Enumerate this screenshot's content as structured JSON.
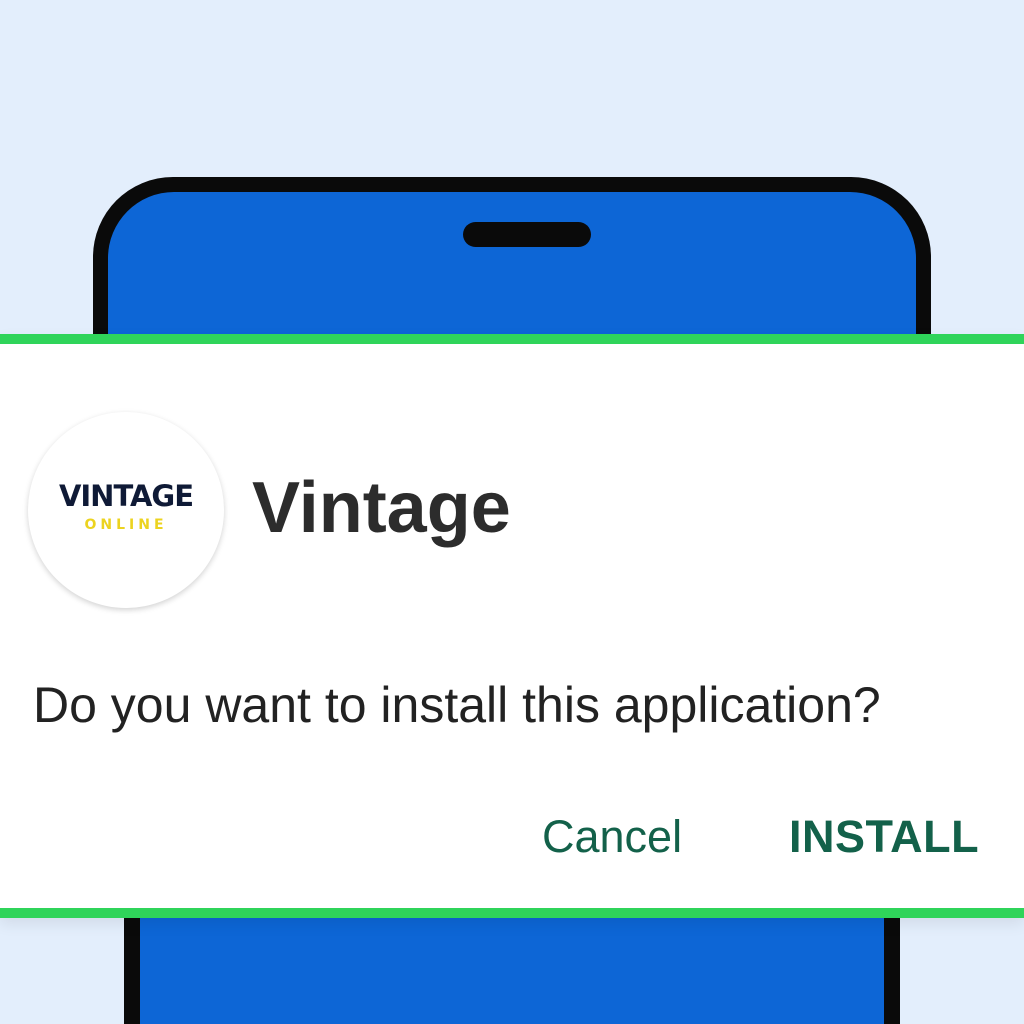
{
  "app": {
    "name": "Vintage",
    "logo": {
      "main_text": "VINTAGE",
      "sub_text": "ONLINE"
    }
  },
  "dialog": {
    "prompt": "Do you want to install this application?",
    "cancel_label": "Cancel",
    "install_label": "INSTALL"
  },
  "colors": {
    "background": "#e3eefc",
    "phone_screen": "#0d66d6",
    "dialog_border": "#2fd45a",
    "button_text": "#13614a",
    "logo_navy": "#0f1a36",
    "logo_yellow": "#ecd31f"
  }
}
